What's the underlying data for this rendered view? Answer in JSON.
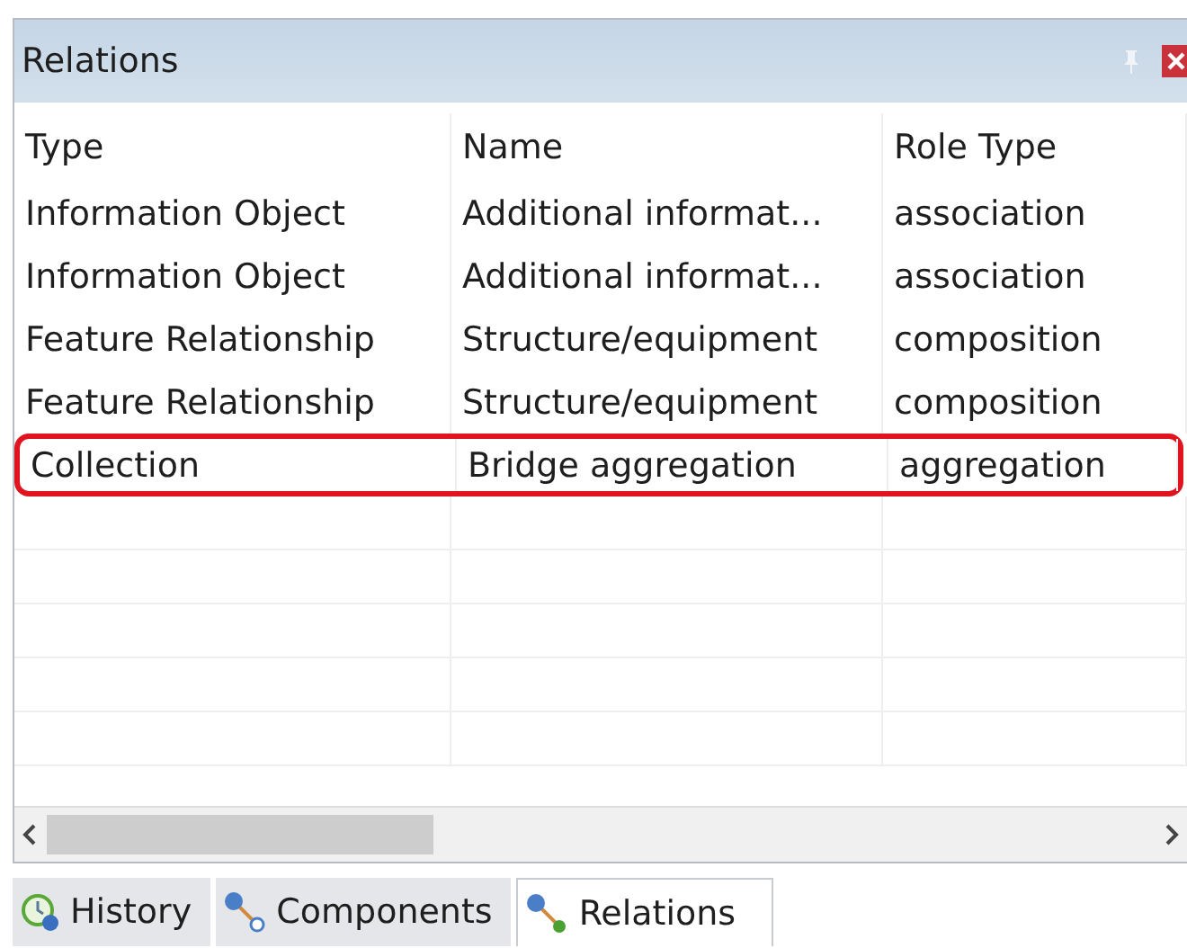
{
  "window": {
    "title": "Relations"
  },
  "table": {
    "columns": [
      "Type",
      "Name",
      "Role Type"
    ],
    "rows": [
      {
        "cells": [
          "Information Object",
          "Additional informat...",
          "association"
        ],
        "highlighted": false
      },
      {
        "cells": [
          "Information Object",
          "Additional informat...",
          "association"
        ],
        "highlighted": false
      },
      {
        "cells": [
          "Feature Relationship",
          "Structure/equipment",
          "composition"
        ],
        "highlighted": false
      },
      {
        "cells": [
          "Feature Relationship",
          "Structure/equipment",
          "composition"
        ],
        "highlighted": false
      },
      {
        "cells": [
          "Collection",
          "Bridge aggregation",
          "aggregation"
        ],
        "highlighted": true
      }
    ]
  },
  "tabs": [
    {
      "label": "History",
      "kind": "history",
      "selected": false
    },
    {
      "label": "Components",
      "kind": "components",
      "selected": false
    },
    {
      "label": "Relations",
      "kind": "relations",
      "selected": true
    }
  ]
}
